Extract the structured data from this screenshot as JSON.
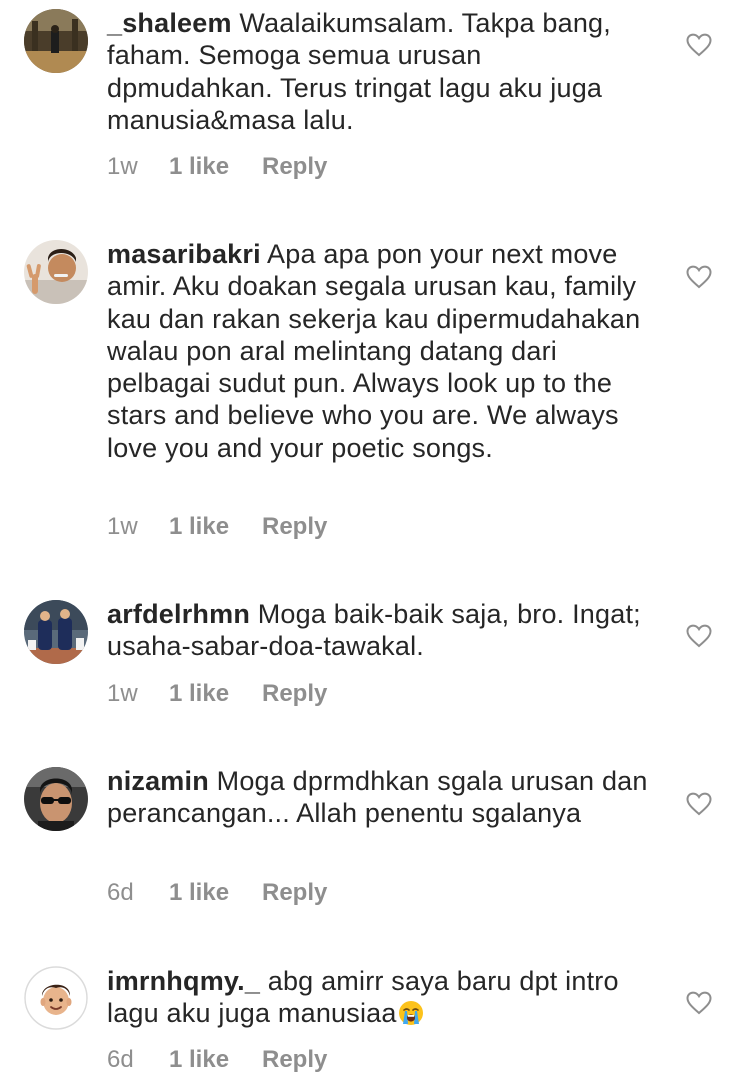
{
  "comments": [
    {
      "username": "_shaleem",
      "text": "Waalaikumsalam. Takpa bang, faham. Semoga semua urusan dpmudahkan. Terus tringat lagu aku juga manusia&masa lalu.",
      "time": "1w",
      "likes": "1 like",
      "reply": "Reply",
      "avatar_icon": "avatar-icon",
      "like_icon": "heart-outline-icon"
    },
    {
      "username": "masaribakri",
      "text": "Apa apa pon your next move amir. Aku doakan segala urusan kau, family kau dan rakan sekerja kau dipermudahakan walau pon aral melintang datang dari pelbagai sudut pun. Always look up to the stars and believe who you are. We always love you and your poetic songs.",
      "time": "1w",
      "likes": "1 like",
      "reply": "Reply",
      "avatar_icon": "avatar-icon",
      "like_icon": "heart-outline-icon"
    },
    {
      "username": "arfdelrhmn",
      "text": "Moga baik-baik saja, bro. Ingat; usaha-sabar-doa-tawakal.",
      "time": "1w",
      "likes": "1 like",
      "reply": "Reply",
      "avatar_icon": "avatar-icon",
      "like_icon": "heart-outline-icon"
    },
    {
      "username": "nizamin",
      "text": "Moga dprmdhkan sgala urusan dan perancangan... Allah penentu sgalanya",
      "time": "6d",
      "likes": "1 like",
      "reply": "Reply",
      "avatar_icon": "avatar-icon",
      "like_icon": "heart-outline-icon"
    },
    {
      "username": "imrnhqmy._",
      "text": "abg amirr saya baru dpt intro lagu aku juga manusiaa",
      "emoji": "loudly-crying-face-emoji",
      "time": "6d",
      "likes": "1 like",
      "reply": "Reply",
      "avatar_icon": "memoji-avatar-icon",
      "like_icon": "heart-outline-icon"
    }
  ],
  "colors": {
    "text": "#262626",
    "meta": "#8e8e8e",
    "background": "#ffffff"
  }
}
